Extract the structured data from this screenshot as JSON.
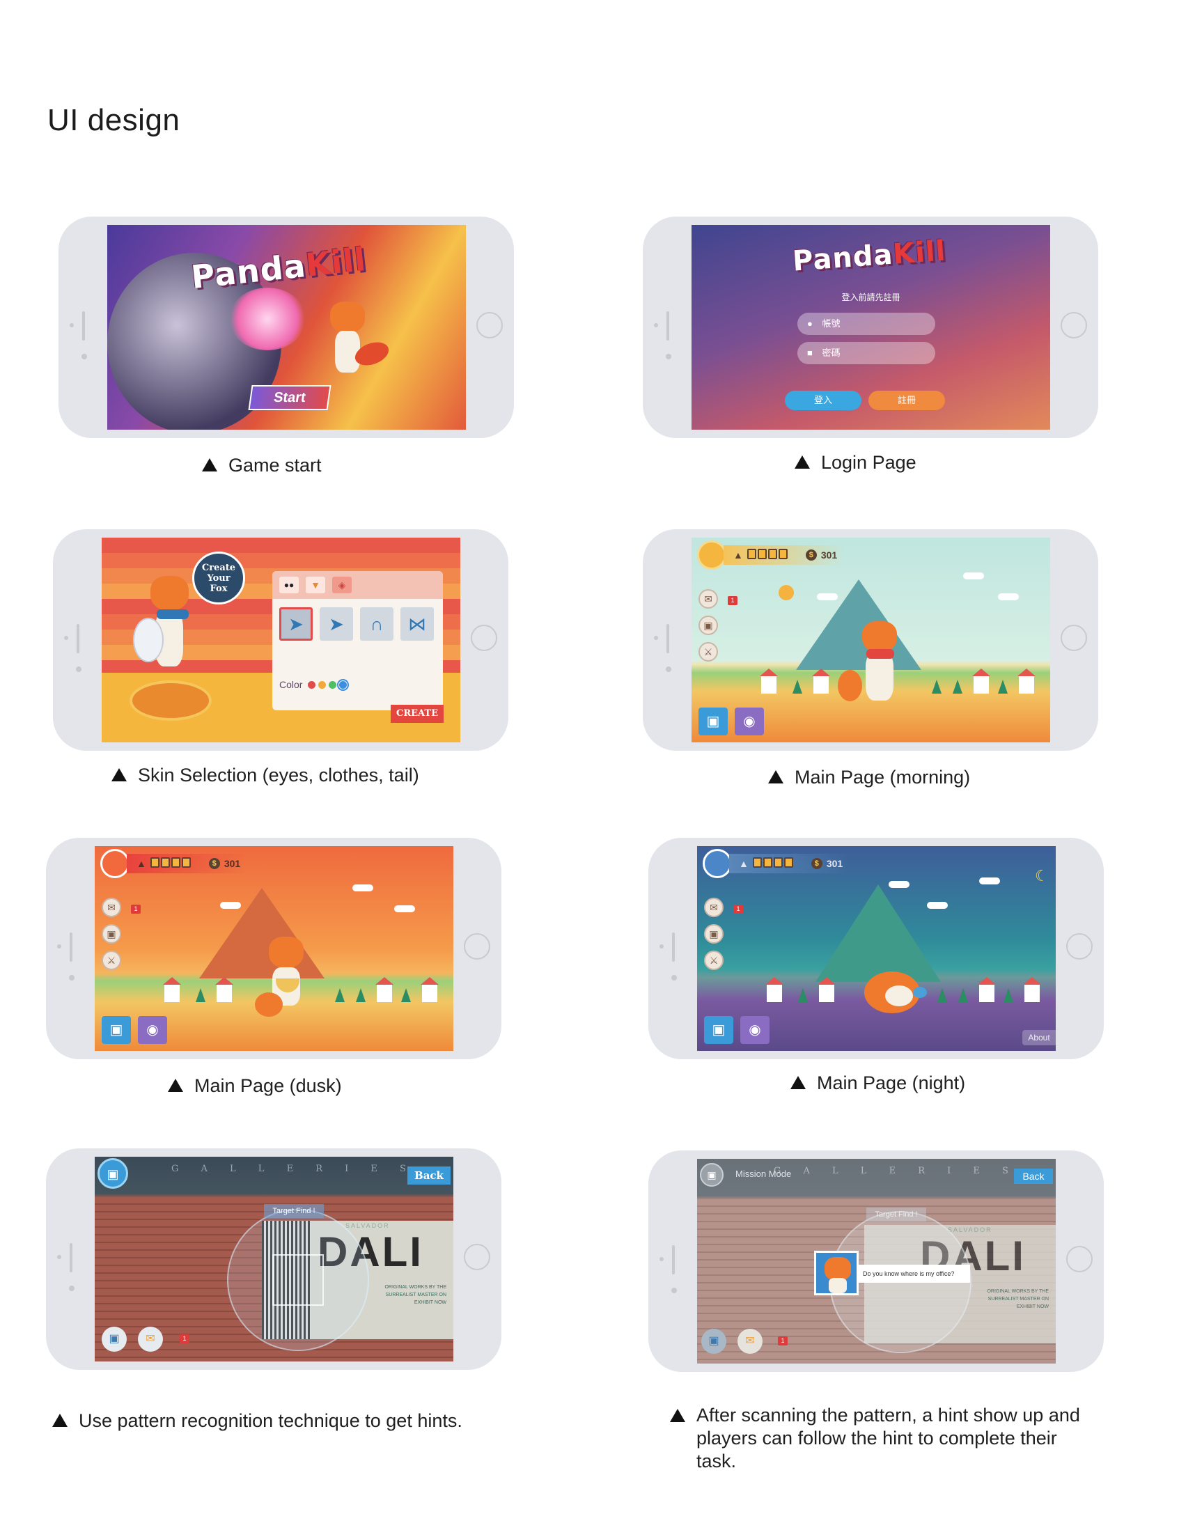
{
  "page_title": "UI design",
  "captions": {
    "game_start": "Game start",
    "login_page": "Login Page",
    "skin_selection": "Skin Selection (eyes, clothes, tail)",
    "main_morning": "Main Page (morning)",
    "main_dusk": "Main Page (dusk)",
    "main_night": "Main Page (night)",
    "pattern": "Use pattern recognition technique to get hints.",
    "hint": "After scanning the pattern, a hint show up and players can follow the hint to complete their task."
  },
  "game": {
    "logo_main": "Panda",
    "logo_kill": "Kill",
    "start_label": "Start"
  },
  "login": {
    "subtitle": "登入前請先註冊",
    "username_placeholder": "帳號",
    "password_placeholder": "密碼",
    "login_button": "登入",
    "register_button": "註冊"
  },
  "skin": {
    "create_badge": "Create Your Fox",
    "color_label": "Color",
    "create_button": "CREATE",
    "swatches": [
      "#e24b4b",
      "#f2a93b",
      "#4fbf63",
      "#3c8fe0"
    ]
  },
  "hud": {
    "coins": "301",
    "mail_count": "1"
  },
  "night": {
    "about_label": "About"
  },
  "ar": {
    "gallery_sign": "G A L L E R I E S",
    "back_label": "Back",
    "target_label": "Target Find !",
    "poster_brand": "SALVADOR",
    "poster_name": "DALI",
    "poster_lines": "ORIGINAL WORKS BY THE SURREALIST MASTER ON EXHIBIT NOW",
    "mission_mode": "Mission Mode",
    "hint_text": "Do you know where is my office?",
    "mail_count": "1"
  }
}
